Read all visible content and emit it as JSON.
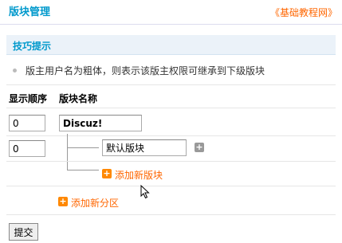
{
  "header": {
    "title": "版块管理",
    "source_link": "《基础教程网》"
  },
  "tips": {
    "title": "技巧提示",
    "text": "版主用户名为粗体，则表示该版主权限可继承到下级版块"
  },
  "columns": {
    "order": "显示顺序",
    "name": "版块名称"
  },
  "rows": [
    {
      "order": "0",
      "name": "Discuz!"
    },
    {
      "order": "0",
      "name": "默认版块"
    }
  ],
  "actions": {
    "add_board": "添加新版块",
    "add_zone": "添加新分区",
    "submit": "提交"
  },
  "colors": {
    "title": "#0099cc",
    "link": "#ff6600",
    "tips_bg": "#ebf2f9"
  },
  "icons": {
    "add": "plus-icon",
    "bullet": "bullet-icon",
    "cursor": "mouse-pointer-icon"
  }
}
